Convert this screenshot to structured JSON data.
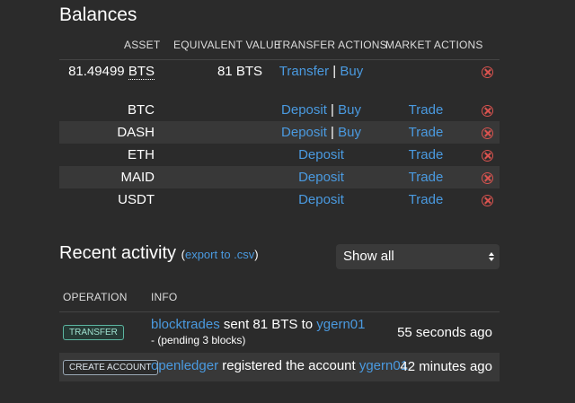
{
  "balances": {
    "title": "Balances",
    "headers": {
      "asset": "ASSET",
      "equivalent_value": "EQUIVALENT VALUE",
      "transfer_actions": "TRANSFER ACTIONS",
      "market_actions": "MARKET ACTIONS"
    },
    "bts": {
      "amount": "81.49499",
      "symbol": "BTS",
      "equivalent": "81 BTS",
      "transfer": "Transfer",
      "separator": "|",
      "buy": "Buy"
    },
    "assets": [
      {
        "name": "BTC",
        "deposit": "Deposit",
        "buy": "Buy",
        "trade": "Trade"
      },
      {
        "name": "DASH",
        "deposit": "Deposit",
        "buy": "Buy",
        "trade": "Trade"
      },
      {
        "name": "ETH",
        "deposit": "Deposit",
        "trade": "Trade"
      },
      {
        "name": "MAID",
        "deposit": "Deposit",
        "trade": "Trade"
      },
      {
        "name": "USDT",
        "deposit": "Deposit",
        "trade": "Trade"
      }
    ]
  },
  "recent": {
    "title": "Recent activity",
    "export_open": "(",
    "export_link": "export to .csv",
    "export_close": ")",
    "filter": "Show all",
    "headers": {
      "operation": "OPERATION",
      "info": "INFO"
    },
    "rows": [
      {
        "tag": "TRANSFER",
        "from": "blocktrades",
        "text": " sent 81 BTS to ",
        "to": "ygern01",
        "sub": "- (pending 3 blocks)",
        "time": "55 seconds ago"
      },
      {
        "tag": "CREATE ACCOUNT",
        "from": "openledger",
        "text": " registered the account ",
        "to": "ygern01",
        "time": "42 minutes ago"
      }
    ]
  },
  "colors": {
    "accent": "#4a9ae0",
    "danger": "#d9534f",
    "background": "#2b2b2b"
  }
}
